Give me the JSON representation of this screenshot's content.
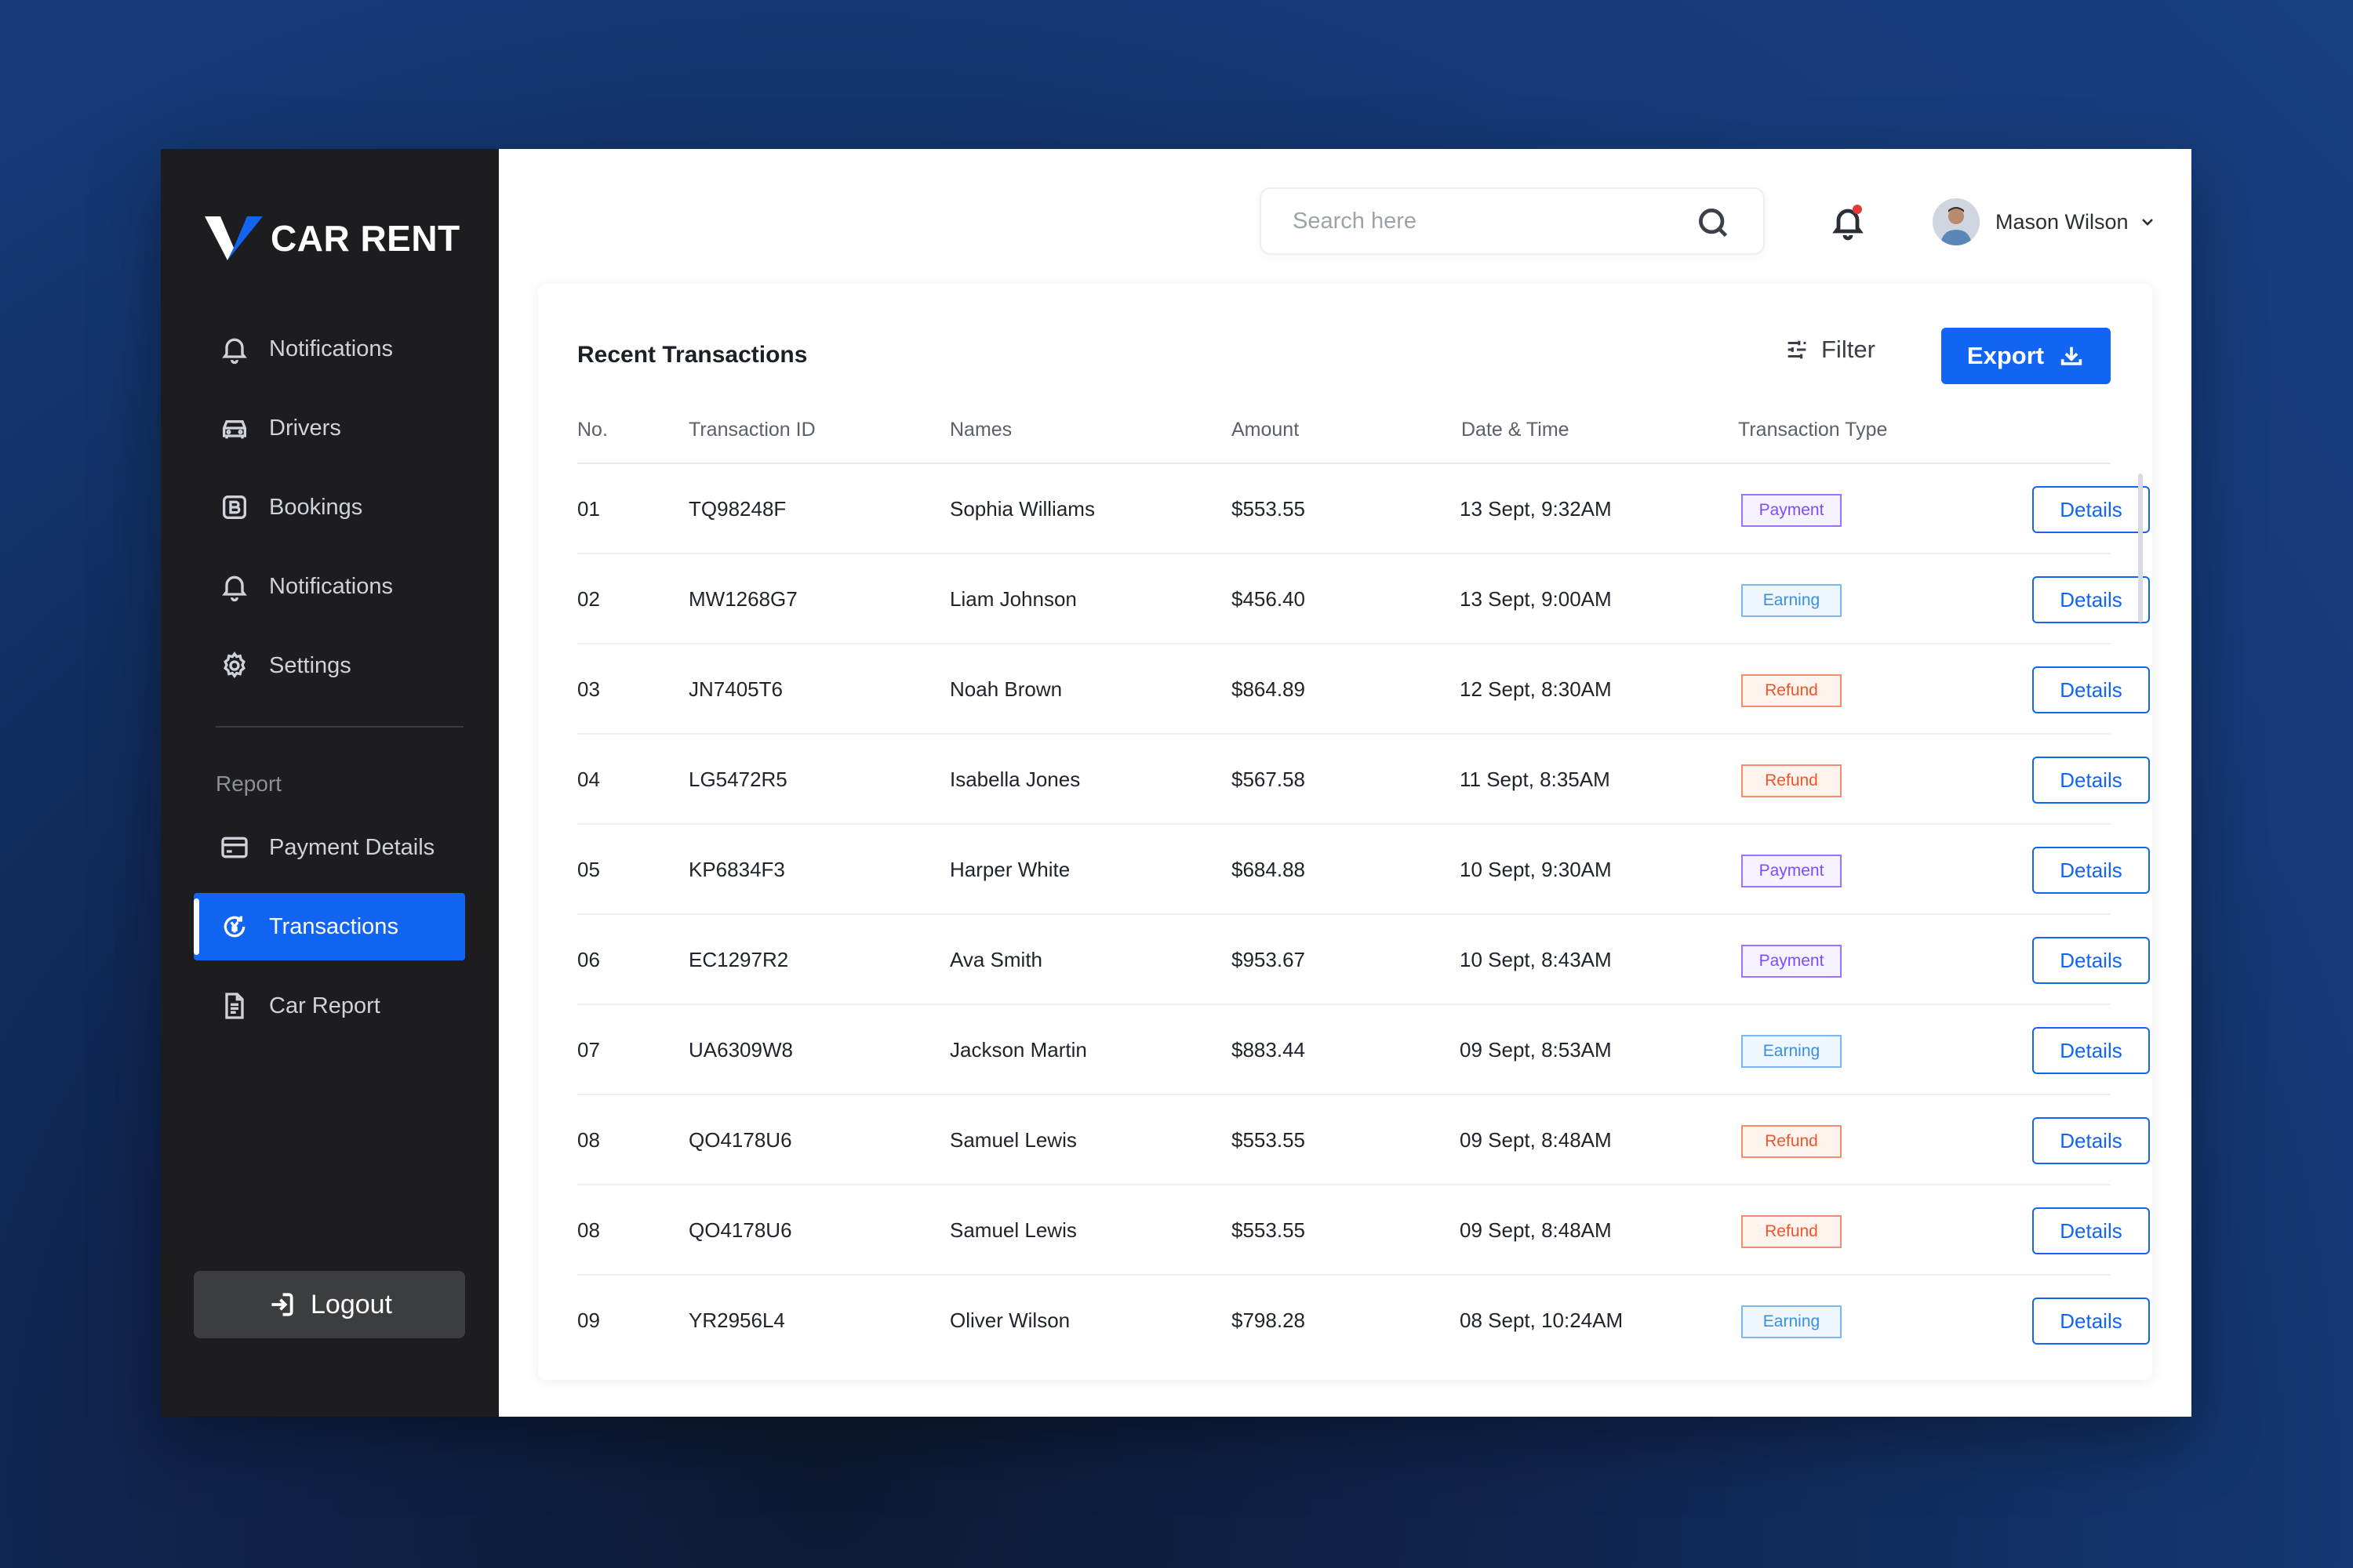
{
  "brand": {
    "name": "CAR RENT",
    "accent": "#1165f2"
  },
  "sidebar": {
    "items": [
      {
        "label": "Notifications",
        "icon": "bell-icon"
      },
      {
        "label": "Drivers",
        "icon": "car-icon"
      },
      {
        "label": "Bookings",
        "icon": "booking-icon"
      },
      {
        "label": "Notifications",
        "icon": "bell-icon"
      },
      {
        "label": "Settings",
        "icon": "gear-icon"
      }
    ],
    "section_label": "Report",
    "report_items": [
      {
        "label": "Payment Details",
        "icon": "card-icon"
      },
      {
        "label": "Transactions",
        "icon": "currency-icon",
        "active": true
      },
      {
        "label": "Car Report",
        "icon": "document-icon"
      }
    ],
    "logout_label": "Logout"
  },
  "header": {
    "search_placeholder": "Search here",
    "user_name": "Mason Wilson",
    "notification_indicator_color": "#e53935"
  },
  "transactions": {
    "title": "Recent Transactions",
    "filter_label": "Filter",
    "export_label": "Export",
    "columns": [
      "No.",
      "Transaction ID",
      "Names",
      "Amount",
      "Date & Time",
      "Transaction Type"
    ],
    "details_label": "Details",
    "type_colors": {
      "Payment": "#7c4dff",
      "Earning": "#3a8ee6",
      "Refund": "#f0552a"
    },
    "rows": [
      {
        "no": "01",
        "id": "TQ98248F",
        "name": "Sophia Williams",
        "amount": "$553.55",
        "datetime": "13 Sept, 9:32AM",
        "type": "Payment"
      },
      {
        "no": "02",
        "id": "MW1268G7",
        "name": "Liam Johnson",
        "amount": "$456.40",
        "datetime": "13 Sept, 9:00AM",
        "type": "Earning"
      },
      {
        "no": "03",
        "id": "JN7405T6",
        "name": "Noah Brown",
        "amount": "$864.89",
        "datetime": "12 Sept, 8:30AM",
        "type": "Refund"
      },
      {
        "no": "04",
        "id": "LG5472R5",
        "name": "Isabella Jones",
        "amount": "$567.58",
        "datetime": "11 Sept, 8:35AM",
        "type": "Refund"
      },
      {
        "no": "05",
        "id": "KP6834F3",
        "name": "Harper White",
        "amount": "$684.88",
        "datetime": "10 Sept, 9:30AM",
        "type": "Payment"
      },
      {
        "no": "06",
        "id": "EC1297R2",
        "name": "Ava Smith",
        "amount": "$953.67",
        "datetime": "10 Sept, 8:43AM",
        "type": "Payment"
      },
      {
        "no": "07",
        "id": "UA6309W8",
        "name": "Jackson Martin",
        "amount": "$883.44",
        "datetime": "09 Sept, 8:53AM",
        "type": "Earning"
      },
      {
        "no": "08",
        "id": "QO4178U6",
        "name": "Samuel Lewis",
        "amount": "$553.55",
        "datetime": "09 Sept, 8:48AM",
        "type": "Refund"
      },
      {
        "no": "08",
        "id": "QO4178U6",
        "name": "Samuel Lewis",
        "amount": "$553.55",
        "datetime": "09 Sept, 8:48AM",
        "type": "Refund"
      },
      {
        "no": "09",
        "id": "YR2956L4",
        "name": "Oliver Wilson",
        "amount": "$798.28",
        "datetime": "08 Sept, 10:24AM",
        "type": "Earning"
      }
    ]
  }
}
